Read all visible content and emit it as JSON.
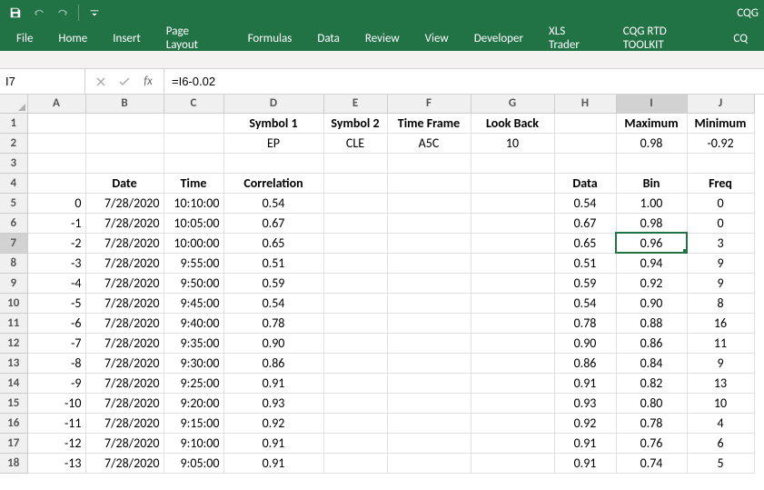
{
  "app": {
    "title_right": "CQG"
  },
  "qat": {
    "save_tip": "Save",
    "undo_tip": "Undo",
    "redo_tip": "Redo",
    "customize_tip": "Customize Quick Access Toolbar"
  },
  "ribbon": {
    "file": "File",
    "home": "Home",
    "insert": "Insert",
    "page_layout": "Page Layout",
    "formulas": "Formulas",
    "data": "Data",
    "review": "Review",
    "view": "View",
    "developer": "Developer",
    "xls_trader": "XLS Trader",
    "cqg_rtd": "CQG RTD TOOLKIT",
    "cq": "CQ"
  },
  "formula_bar": {
    "name_box": "I7",
    "formula": "=I6-0.02",
    "fx": "fx"
  },
  "columns": [
    "A",
    "B",
    "C",
    "D",
    "E",
    "F",
    "G",
    "H",
    "I",
    "J"
  ],
  "headers1": {
    "D": "Symbol 1",
    "E": "Symbol 2",
    "F": "Time Frame",
    "G": "Look Back",
    "I": "Maximum",
    "J": "Minimum"
  },
  "row2": {
    "D": "EP",
    "E": "CLE",
    "F": "A5C",
    "G": "10",
    "I": "0.98",
    "J": "-0.92"
  },
  "headers4": {
    "B": "Date",
    "C": "Time",
    "D": "Correlation",
    "H": "Data",
    "I": "Bin",
    "J": "Freq"
  },
  "rows": [
    {
      "n": "5",
      "A": "0",
      "B": "7/28/2020",
      "C": "10:10:00",
      "D": "0.54",
      "H": "0.54",
      "I": "1.00",
      "J": "0"
    },
    {
      "n": "6",
      "A": "-1",
      "B": "7/28/2020",
      "C": "10:05:00",
      "D": "0.67",
      "H": "0.67",
      "I": "0.98",
      "J": "0"
    },
    {
      "n": "7",
      "A": "-2",
      "B": "7/28/2020",
      "C": "10:00:00",
      "D": "0.65",
      "H": "0.65",
      "I": "0.96",
      "J": "3"
    },
    {
      "n": "8",
      "A": "-3",
      "B": "7/28/2020",
      "C": "9:55:00",
      "D": "0.51",
      "H": "0.51",
      "I": "0.94",
      "J": "9"
    },
    {
      "n": "9",
      "A": "-4",
      "B": "7/28/2020",
      "C": "9:50:00",
      "D": "0.59",
      "H": "0.59",
      "I": "0.92",
      "J": "9"
    },
    {
      "n": "10",
      "A": "-5",
      "B": "7/28/2020",
      "C": "9:45:00",
      "D": "0.54",
      "H": "0.54",
      "I": "0.90",
      "J": "8"
    },
    {
      "n": "11",
      "A": "-6",
      "B": "7/28/2020",
      "C": "9:40:00",
      "D": "0.78",
      "H": "0.78",
      "I": "0.88",
      "J": "16"
    },
    {
      "n": "12",
      "A": "-7",
      "B": "7/28/2020",
      "C": "9:35:00",
      "D": "0.90",
      "H": "0.90",
      "I": "0.86",
      "J": "11"
    },
    {
      "n": "13",
      "A": "-8",
      "B": "7/28/2020",
      "C": "9:30:00",
      "D": "0.86",
      "H": "0.86",
      "I": "0.84",
      "J": "9"
    },
    {
      "n": "14",
      "A": "-9",
      "B": "7/28/2020",
      "C": "9:25:00",
      "D": "0.91",
      "H": "0.91",
      "I": "0.82",
      "J": "13"
    },
    {
      "n": "15",
      "A": "-10",
      "B": "7/28/2020",
      "C": "9:20:00",
      "D": "0.93",
      "H": "0.93",
      "I": "0.80",
      "J": "10"
    },
    {
      "n": "16",
      "A": "-11",
      "B": "7/28/2020",
      "C": "9:15:00",
      "D": "0.92",
      "H": "0.92",
      "I": "0.78",
      "J": "4"
    },
    {
      "n": "17",
      "A": "-12",
      "B": "7/28/2020",
      "C": "9:10:00",
      "D": "0.91",
      "H": "0.91",
      "I": "0.76",
      "J": "6"
    },
    {
      "n": "18",
      "A": "-13",
      "B": "7/28/2020",
      "C": "9:05:00",
      "D": "0.91",
      "H": "0.91",
      "I": "0.74",
      "J": "5"
    }
  ],
  "selected_cell": "I7"
}
